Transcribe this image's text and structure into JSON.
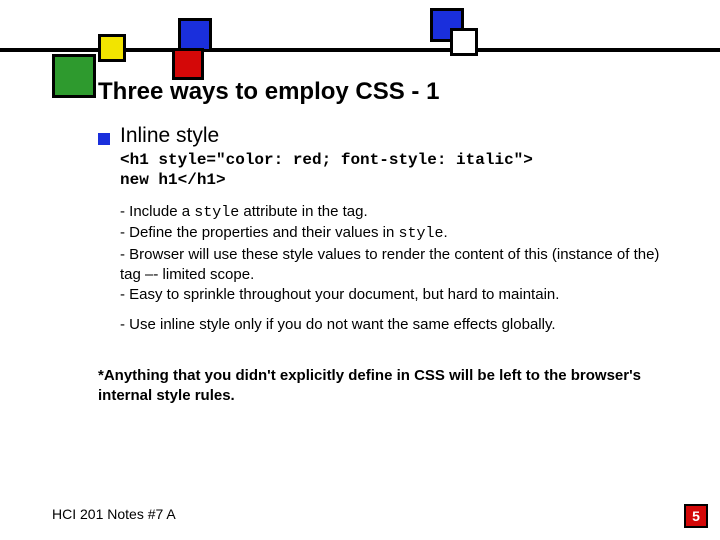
{
  "title": "Three ways to employ CSS - 1",
  "section": {
    "heading": "Inline style",
    "code": "<h1 style=\"color: red; font-style: italic\">\nnew h1</h1>",
    "points_html": "- Include a <span class=\"mono\">style</span> attribute in the tag.<br>- Define the properties and their values in <span class=\"mono\">style</span>.<br>- Browser will use these style values to render the content of this (instance of the) tag –- limited scope.<br>- Easy to sprinkle throughout your document, but hard to maintain.",
    "extra": "- Use inline style only if you do not want the same effects globally."
  },
  "note": "*Anything that you didn't explicitly define in CSS will be left to the browser's internal style rules.",
  "footer": "HCI 201 Notes #7 A",
  "page": "5"
}
